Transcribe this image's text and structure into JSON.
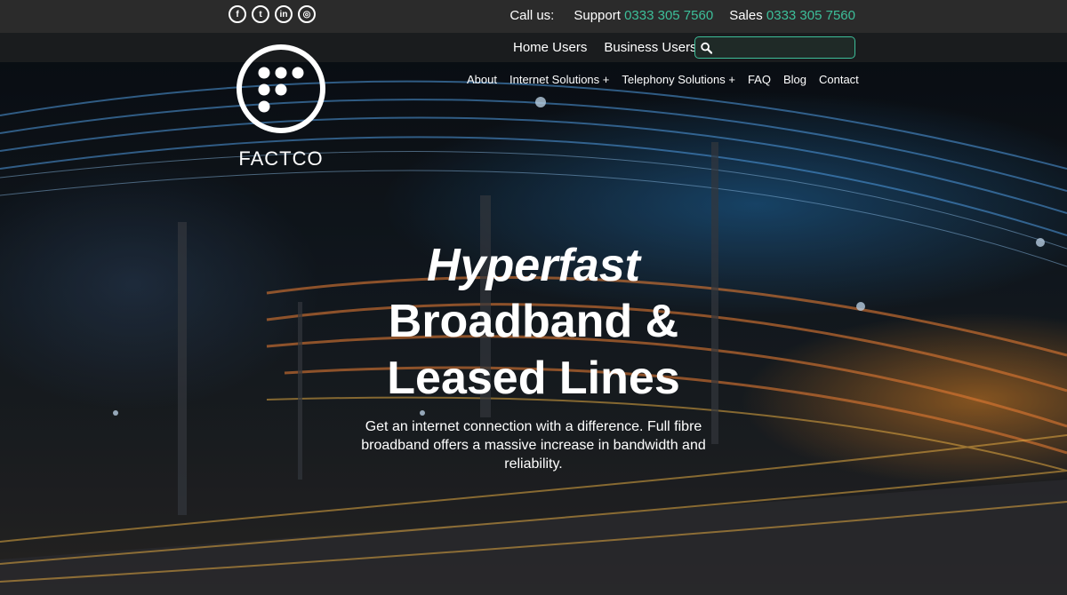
{
  "social": [
    {
      "icon": "facebook-icon",
      "glyph": "f"
    },
    {
      "icon": "twitter-icon",
      "glyph": "t"
    },
    {
      "icon": "linkedin-icon",
      "glyph": "in"
    },
    {
      "icon": "instagram-icon",
      "glyph": "◎"
    }
  ],
  "contact": {
    "call_label": "Call us:",
    "support_label": "Support",
    "support_number": "0333 305 7560",
    "sales_label": "Sales",
    "sales_number": "0333 305 7560"
  },
  "users_nav": {
    "home": "Home Users",
    "business": "Business Users"
  },
  "search": {
    "icon": "search-icon",
    "value": ""
  },
  "main_nav": {
    "about": "About",
    "internet": "Internet Solutions +",
    "telephony": "Telephony Solutions +",
    "faq": "FAQ",
    "blog": "Blog",
    "contact": "Contact"
  },
  "logo": {
    "word": "FACTCO"
  },
  "hero": {
    "line1": "Hyperfast",
    "line2": "Broadband &",
    "line3": "Leased Lines",
    "subtitle": "Get an internet connection with a difference. Full fibre broadband offers a massive increase in bandwidth and reliability."
  },
  "colors": {
    "accent": "#3dbf9a",
    "topbar": "#2b2b2b"
  }
}
